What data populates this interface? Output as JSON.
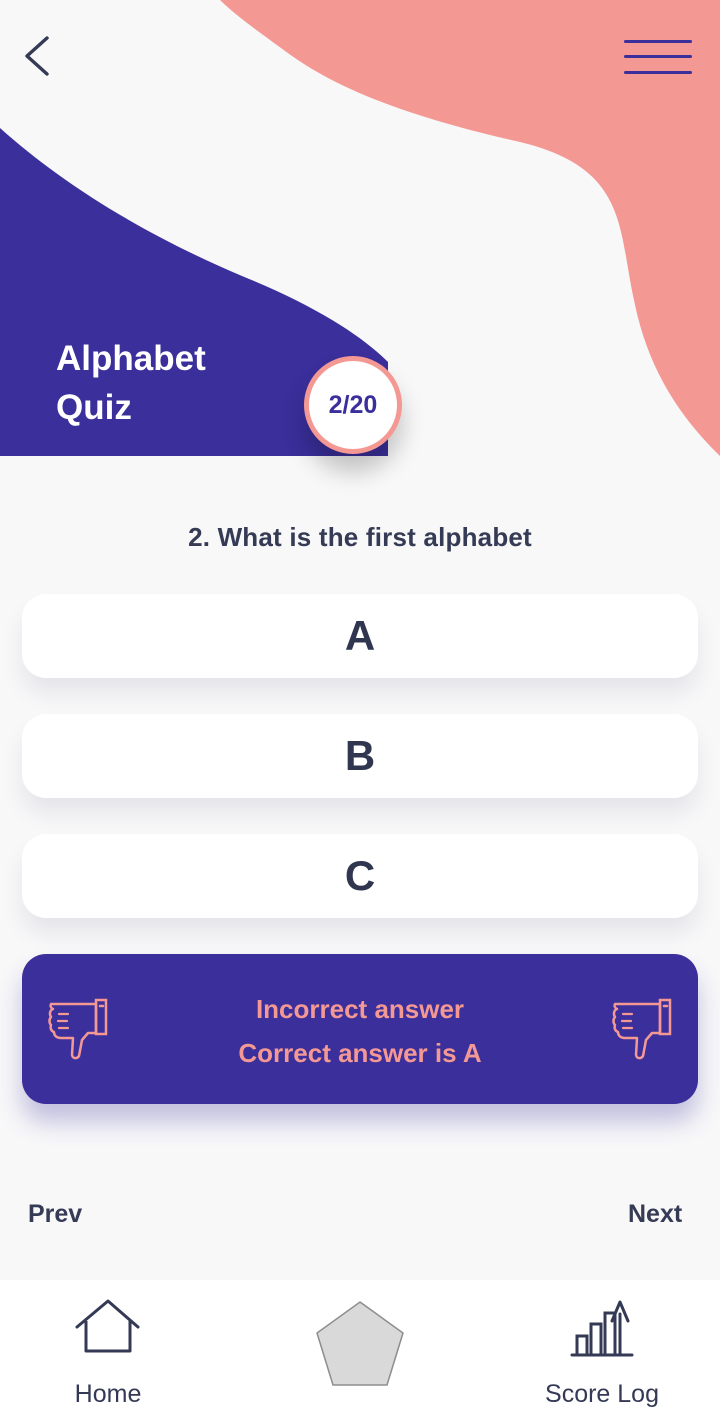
{
  "colors": {
    "indigo": "#3a2f9b",
    "coral": "#f49894",
    "background": "#f8f8f9",
    "text_dark": "#353a55",
    "white": "#ffffff",
    "shape_gray": "#d9d9d9"
  },
  "header": {
    "back_icon": "chevron-left-icon",
    "menu_icon": "hamburger-menu-icon",
    "title_line_1": "Alphabet",
    "title_line_2": "Quiz",
    "progress": "2/20"
  },
  "question": {
    "text": "2. What is the first alphabet",
    "options": [
      "A",
      "B",
      "C"
    ]
  },
  "feedback": {
    "line_1": "Incorrect answer",
    "line_2": "Correct answer is A",
    "icon": "thumbs-down-icon"
  },
  "navigation": {
    "prev_label": "Prev",
    "next_label": "Next"
  },
  "bottom_nav": {
    "home_label": "Home",
    "score_log_label": "Score Log",
    "home_icon": "home-icon",
    "score_icon": "bar-chart-up-icon",
    "center_icon": "pentagon-icon"
  }
}
